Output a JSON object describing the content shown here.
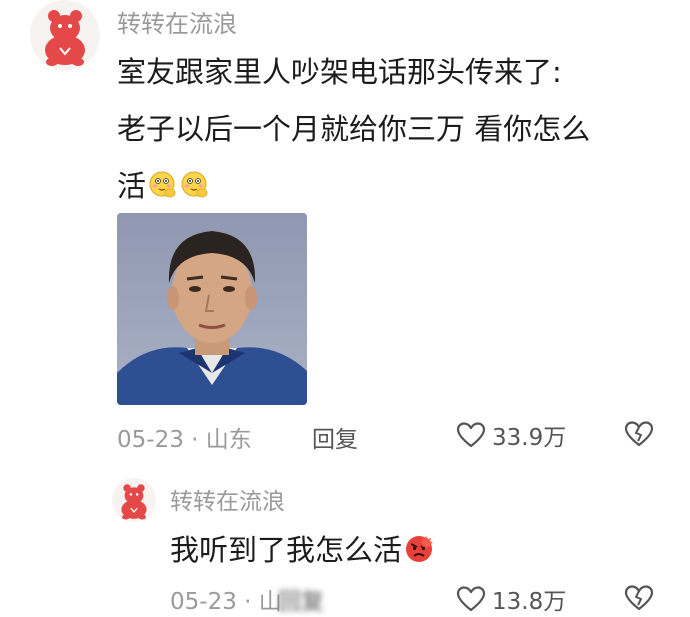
{
  "main_comment": {
    "username": "转转在流浪",
    "text_line1": "室友跟家里人吵架电话那头传来了:",
    "text_line2": "老子以后一个月就给你三万 看你怎么",
    "text_line3": "活",
    "emojis": [
      "thinking-smirk-emoji",
      "thinking-smirk-emoji"
    ],
    "date_location": "05-23 · 山东",
    "reply_label": "回复",
    "like_count": "33.9万"
  },
  "reply_comment": {
    "username": "转转在流浪",
    "text": "我听到了我怎么活",
    "emoji": "angry-face-emoji",
    "date_location": "05-23 · 山东",
    "reply_label": "回复",
    "like_count": "13.8万"
  },
  "colors": {
    "muted_text": "#9a9a9a",
    "body_text": "#1c1c1c",
    "action_text": "#555555",
    "avatar_red": "#e54848"
  }
}
